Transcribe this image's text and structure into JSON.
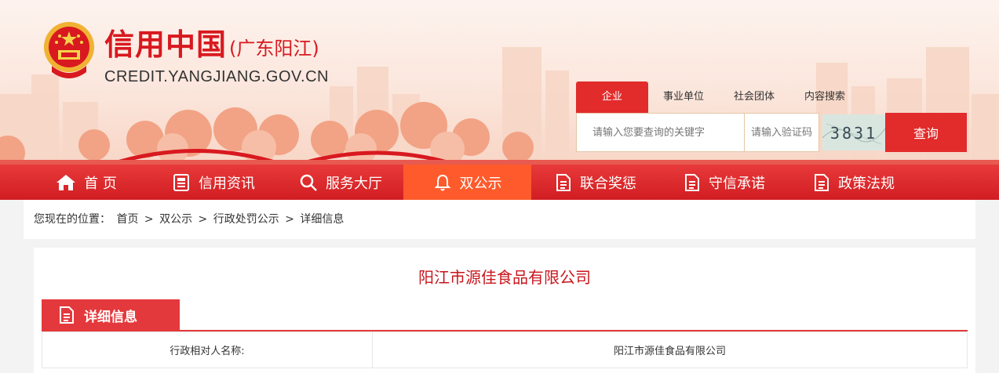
{
  "header": {
    "title": "信用中国",
    "region": "(广东阳江)",
    "url": "CREDIT.YANGJIANG.GOV.CN",
    "emblem_icon": "national-emblem-icon"
  },
  "search": {
    "tabs": [
      {
        "label": "企业",
        "active": true
      },
      {
        "label": "事业单位",
        "active": false
      },
      {
        "label": "社会团体",
        "active": false
      },
      {
        "label": "内容搜索",
        "active": false
      }
    ],
    "keyword_placeholder": "请输入您要查询的关键字",
    "captcha_placeholder": "请输入验证码",
    "captcha_text": "3831",
    "button_label": "查询"
  },
  "nav": {
    "items": [
      {
        "label": "首 页",
        "icon": "home-icon"
      },
      {
        "label": "信用资讯",
        "icon": "newspaper-icon"
      },
      {
        "label": "服务大厅",
        "icon": "search-icon"
      },
      {
        "label": "双公示",
        "icon": "bell-icon",
        "active": true
      },
      {
        "label": "联合奖惩",
        "icon": "document-icon"
      },
      {
        "label": "守信承诺",
        "icon": "document-icon"
      },
      {
        "label": "政策法规",
        "icon": "document-icon"
      }
    ]
  },
  "breadcrumb": {
    "prefix": "您现在的位置：",
    "items": [
      "首页",
      "双公示",
      "行政处罚公示",
      "详细信息"
    ],
    "separator": ">"
  },
  "detail": {
    "company_title": "阳江市源佳食品有限公司",
    "section_title": "详细信息",
    "rows": [
      {
        "key": "行政相对人名称:",
        "value": "阳江市源佳食品有限公司"
      }
    ]
  },
  "colors": {
    "brand_red": "#d8191f",
    "nav_red": "#d11d22",
    "nav_active": "#ff5a2b",
    "button_red": "#e22b2b"
  }
}
